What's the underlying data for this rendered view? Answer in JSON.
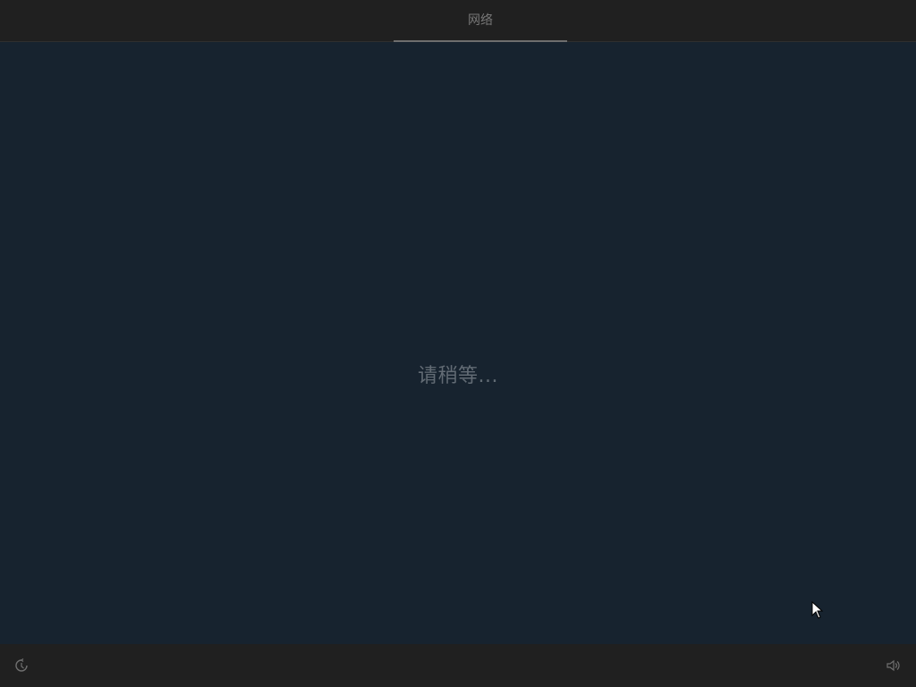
{
  "topbar": {
    "active_tab": "网络"
  },
  "main": {
    "status_text": "请稍等..."
  },
  "bottombar": {
    "left_icon": "power-icon",
    "right_icon": "volume-icon"
  },
  "colors": {
    "background": "#17232f",
    "bar": "#202020",
    "text": "#777777"
  }
}
